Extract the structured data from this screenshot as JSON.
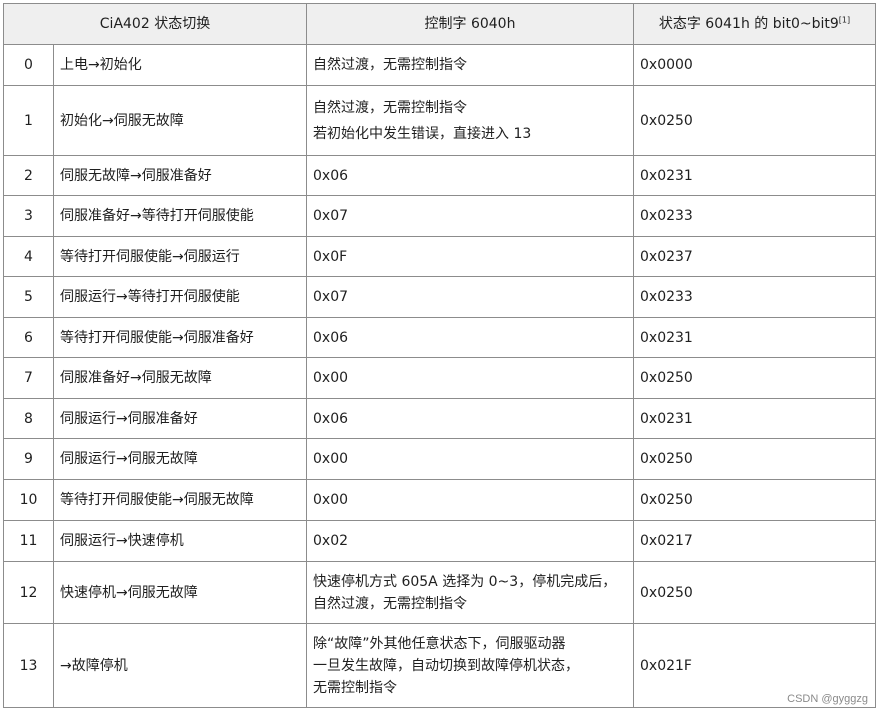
{
  "table": {
    "headers": {
      "transition": "CiA402 状态切换",
      "control_word": "控制字 6040h",
      "status_word": "状态字 6041h 的 bit0~bit9",
      "status_word_note": "[1]"
    },
    "rows": [
      {
        "index": "0",
        "transition": "上电→初始化",
        "control_word": [
          "自然过渡，无需控制指令"
        ],
        "status_word": "0x0000"
      },
      {
        "index": "1",
        "transition": "初始化→伺服无故障",
        "control_word": [
          "自然过渡，无需控制指令",
          "若初始化中发生错误，直接进入 13"
        ],
        "status_word": "0x0250"
      },
      {
        "index": "2",
        "transition": "伺服无故障→伺服准备好",
        "control_word": [
          "0x06"
        ],
        "status_word": "0x0231"
      },
      {
        "index": "3",
        "transition": "伺服准备好→等待打开伺服使能",
        "control_word": [
          "0x07"
        ],
        "status_word": "0x0233"
      },
      {
        "index": "4",
        "transition": "等待打开伺服使能→伺服运行",
        "control_word": [
          "0x0F"
        ],
        "status_word": "0x0237"
      },
      {
        "index": "5",
        "transition": "伺服运行→等待打开伺服使能",
        "control_word": [
          "0x07"
        ],
        "status_word": "0x0233"
      },
      {
        "index": "6",
        "transition": "等待打开伺服使能→伺服准备好",
        "control_word": [
          "0x06"
        ],
        "status_word": "0x0231"
      },
      {
        "index": "7",
        "transition": "伺服准备好→伺服无故障",
        "control_word": [
          "0x00"
        ],
        "status_word": "0x0250"
      },
      {
        "index": "8",
        "transition": "伺服运行→伺服准备好",
        "control_word": [
          "0x06"
        ],
        "status_word": "0x0231"
      },
      {
        "index": "9",
        "transition": "伺服运行→伺服无故障",
        "control_word": [
          "0x00"
        ],
        "status_word": "0x0250"
      },
      {
        "index": "10",
        "transition": "等待打开伺服使能→伺服无故障",
        "control_word": [
          "0x00"
        ],
        "status_word": "0x0250"
      },
      {
        "index": "11",
        "transition": "伺服运行→快速停机",
        "control_word": [
          "0x02"
        ],
        "status_word": "0x0217"
      },
      {
        "index": "12",
        "transition": "快速停机→伺服无故障",
        "control_word": [
          "快速停机方式 605A 选择为 0~3，停机完成后，",
          "自然过渡，无需控制指令"
        ],
        "status_word": "0x0250"
      },
      {
        "index": "13",
        "transition": "→故障停机",
        "control_word": [
          "除“故障”外其他任意状态下，伺服驱动器",
          "一旦发生故障，自动切换到故障停机状态，",
          "无需控制指令"
        ],
        "status_word": "0x021F"
      }
    ]
  },
  "watermark": "CSDN @gyggzg"
}
